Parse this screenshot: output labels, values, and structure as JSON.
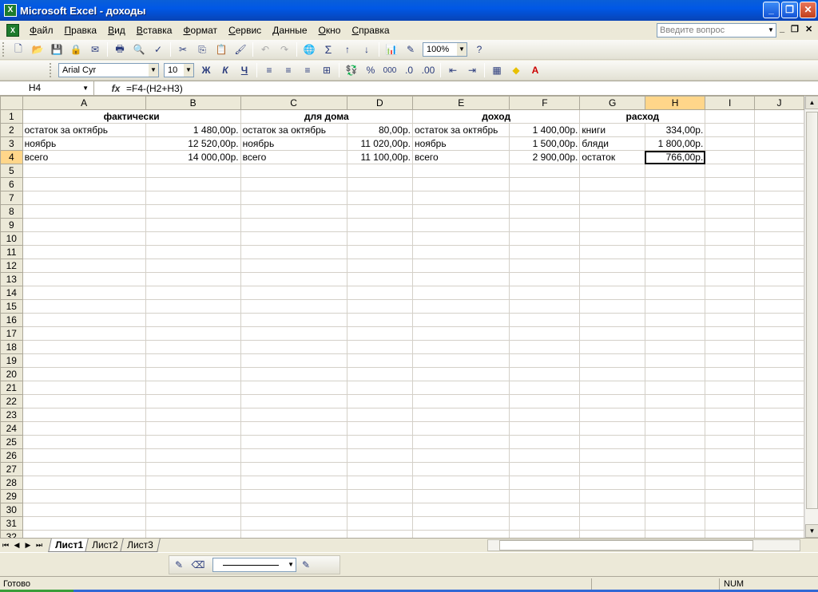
{
  "window": {
    "title": "Microsoft Excel - доходы"
  },
  "menu": [
    "Файл",
    "Правка",
    "Вид",
    "Вставка",
    "Формат",
    "Сервис",
    "Данные",
    "Окно",
    "Справка"
  ],
  "ask_placeholder": "Введите вопрос",
  "toolbar": {
    "zoom": "100%",
    "font_name": "Arial Cyr",
    "font_size": "10",
    "bold": "Ж",
    "italic": "К",
    "underline": "Ч",
    "percent": "%",
    "thousands": "000",
    "autosum": "Σ"
  },
  "formula_bar": {
    "name_box": "H4",
    "fx": "fx",
    "formula": "=F4-(H2+H3)"
  },
  "columns": [
    "A",
    "B",
    "C",
    "D",
    "E",
    "F",
    "G",
    "H",
    "I",
    "J"
  ],
  "rows": [
    [
      "фактически",
      "",
      "для дома",
      "",
      "доход",
      "",
      "расход",
      "",
      "",
      ""
    ],
    [
      "остаток за октябрь",
      "1 480,00р.",
      "остаток за октябрь",
      "80,00р.",
      "остаток за октябрь",
      "1 400,00р.",
      "книги",
      "334,00р.",
      "",
      ""
    ],
    [
      "ноябрь",
      "12 520,00р.",
      "ноябрь",
      "11 020,00р.",
      "ноябрь",
      "1 500,00р.",
      "бляди",
      "1 800,00р.",
      "",
      ""
    ],
    [
      "всего",
      "14 000,00р.",
      "всего",
      "11 100,00р.",
      "всего",
      "2 900,00р.",
      "остаток",
      "766,00р.",
      "",
      ""
    ]
  ],
  "empty_row_start": 5,
  "empty_row_end": 32,
  "sheets": [
    "Лист1",
    "Лист2",
    "Лист3"
  ],
  "status": {
    "text": "Готово",
    "num": "NUM"
  }
}
